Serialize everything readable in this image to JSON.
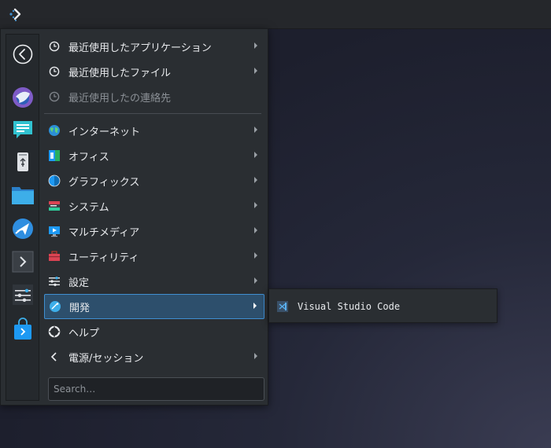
{
  "menu": {
    "categories": [
      {
        "label": "最近使用したアプリケーション",
        "icon": "clock-icon",
        "submenu": true,
        "disabled": false
      },
      {
        "label": "最近使用したファイル",
        "icon": "clock-icon",
        "submenu": true,
        "disabled": false
      },
      {
        "label": "最近使用したの連絡先",
        "icon": "clock-icon",
        "submenu": false,
        "disabled": true
      },
      {
        "label": "インターネット",
        "icon": "globe-icon",
        "submenu": true
      },
      {
        "label": "オフィス",
        "icon": "office-icon",
        "submenu": true
      },
      {
        "label": "グラフィックス",
        "icon": "graphics-icon",
        "submenu": true
      },
      {
        "label": "システム",
        "icon": "system-icon",
        "submenu": true
      },
      {
        "label": "マルチメディア",
        "icon": "multimedia-icon",
        "submenu": true
      },
      {
        "label": "ユーティリティ",
        "icon": "toolbox-icon",
        "submenu": true
      },
      {
        "label": "設定",
        "icon": "settings-sliders-icon",
        "submenu": true
      },
      {
        "label": "開発",
        "icon": "development-icon",
        "submenu": true,
        "active": true
      },
      {
        "label": "ヘルプ",
        "icon": "help-lifebuoy-icon",
        "submenu": false
      },
      {
        "label": "電源/セッション",
        "icon": "chevron-left-icon",
        "submenu": true
      }
    ],
    "search_placeholder": "Search…"
  },
  "favorites": [
    "back-circle-icon",
    "thunderbird-mail-icon",
    "chat-icon",
    "usb-device-icon",
    "folder-icon",
    "plane-app-icon",
    "terminal-icon",
    "settings-sliders-icon",
    "store-bag-icon"
  ],
  "submenu": {
    "items": [
      {
        "label": "Visual Studio Code",
        "icon": "vscode-icon"
      }
    ]
  },
  "colors": {
    "accent": "#3f8fd1",
    "menu_bg": "#2a2e32",
    "active_bg": "#2d4f6c"
  }
}
